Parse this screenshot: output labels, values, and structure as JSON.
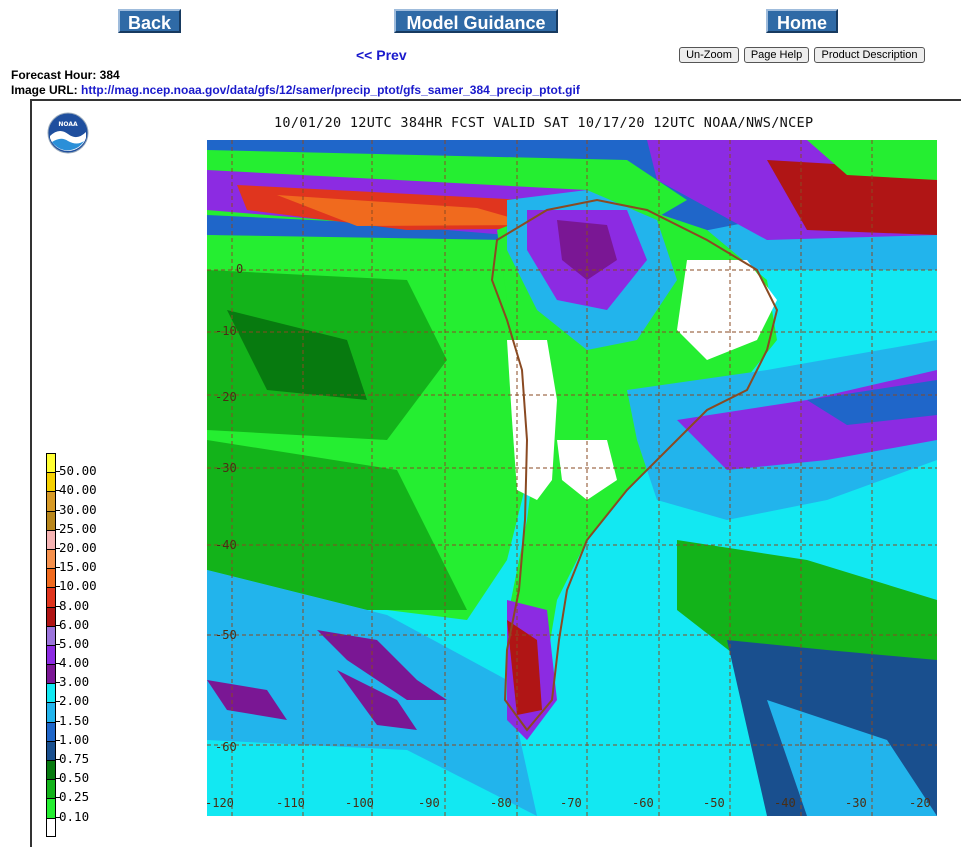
{
  "nav": {
    "back": "Back",
    "model_guidance": "Model Guidance",
    "home": "Home",
    "prev": "<< Prev",
    "unzoom": "Un-Zoom",
    "page_help": "Page Help",
    "product_description": "Product Description"
  },
  "info": {
    "forecast_hour": "Forecast Hour: 384",
    "image_url_label": "Image URL: ",
    "image_url": "http://mag.ncep.noaa.gov/data/gfs/12/samer/precip_ptot/gfs_samer_384_precip_ptot.gif"
  },
  "map": {
    "title": "10/01/20 12UTC 384HR FCST VALID SAT 10/17/20 12UTC NOAA/NWS/NCEP",
    "logo_text": "NOAA",
    "x_ticks": [
      "-120",
      "-110",
      "-100",
      "-90",
      "-80",
      "-70",
      "-60",
      "-50",
      "-40",
      "-30",
      "-20"
    ],
    "y_ticks": [
      "0",
      "-10",
      "-20",
      "-30",
      "-40",
      "-50",
      "-60"
    ],
    "legend": [
      {
        "label": "50.00",
        "color": "#ffff33"
      },
      {
        "label": "40.00",
        "color": "#f5d000"
      },
      {
        "label": "30.00",
        "color": "#d79a26"
      },
      {
        "label": "25.00",
        "color": "#b8861b"
      },
      {
        "label": "20.00",
        "color": "#f5b3b3"
      },
      {
        "label": "15.00",
        "color": "#f6914d"
      },
      {
        "label": "10.00",
        "color": "#f06a1e"
      },
      {
        "label": "8.00",
        "color": "#e0351e"
      },
      {
        "label": "6.00",
        "color": "#b01515"
      },
      {
        "label": "5.00",
        "color": "#9b74dc"
      },
      {
        "label": "4.00",
        "color": "#8c2be2"
      },
      {
        "label": "3.00",
        "color": "#7a1794"
      },
      {
        "label": "2.00",
        "color": "#12e8f2"
      },
      {
        "label": "1.50",
        "color": "#22b4ec"
      },
      {
        "label": "1.00",
        "color": "#1f66c9"
      },
      {
        "label": "0.75",
        "color": "#194f8e"
      },
      {
        "label": "0.50",
        "color": "#077a0f"
      },
      {
        "label": "0.25",
        "color": "#13b31a"
      },
      {
        "label": "0.10",
        "color": "#25ee31"
      },
      {
        "label": "",
        "color": "#ffffff"
      }
    ],
    "colors": {
      "ocean_low": "#12e8f2",
      "ocean_mid": "#22b4ec",
      "land_green": "#25ee31",
      "dry": "#ffffff",
      "heavy": "#8c2be2",
      "extreme": "#e0351e",
      "coast": "#8a4a22",
      "grid": "#8a4a22"
    }
  }
}
